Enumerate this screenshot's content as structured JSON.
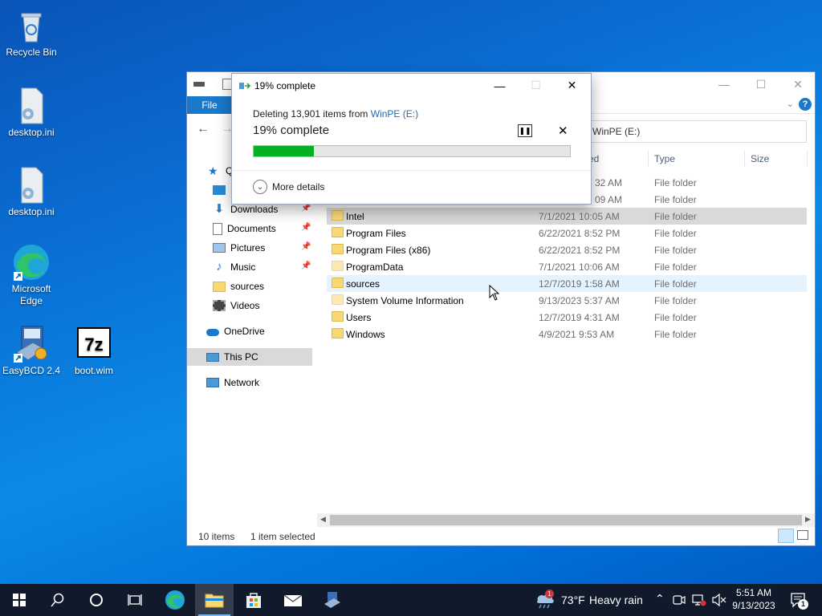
{
  "desktop": {
    "icons": [
      {
        "label": "Recycle Bin"
      },
      {
        "label": "desktop.ini"
      },
      {
        "label": "desktop.ini"
      },
      {
        "label": "Microsoft Edge"
      },
      {
        "label": "EasyBCD 2.4"
      },
      {
        "label": "boot.wim"
      }
    ]
  },
  "explorer": {
    "ribbon": {
      "file_tab": "File"
    },
    "address": "WinPE (E:)",
    "nav": {
      "quick_access": "Qu",
      "desktop": "D",
      "downloads": "Downloads",
      "documents": "Documents",
      "pictures": "Pictures",
      "music": "Music",
      "sources": "sources",
      "videos": "Videos",
      "onedrive": "OneDrive",
      "this_pc": "This PC",
      "network": "Network"
    },
    "columns": {
      "date": "ed",
      "type": "Type",
      "size": "Size"
    },
    "rows": [
      {
        "name": "",
        "date": "32 AM",
        "type": "File folder"
      },
      {
        "name": "",
        "date": "09 AM",
        "type": "File folder"
      },
      {
        "name": "Intel",
        "date": "7/1/2021 10:05 AM",
        "type": "File folder"
      },
      {
        "name": "Program Files",
        "date": "6/22/2021 8:52 PM",
        "type": "File folder"
      },
      {
        "name": "Program Files (x86)",
        "date": "6/22/2021 8:52 PM",
        "type": "File folder"
      },
      {
        "name": "ProgramData",
        "date": "7/1/2021 10:06 AM",
        "type": "File folder"
      },
      {
        "name": "sources",
        "date": "12/7/2019 1:58 AM",
        "type": "File folder"
      },
      {
        "name": "System Volume Information",
        "date": "9/13/2023 5:37 AM",
        "type": "File folder"
      },
      {
        "name": "Users",
        "date": "12/7/2019 4:31 AM",
        "type": "File folder"
      },
      {
        "name": "Windows",
        "date": "4/9/2021 9:53 AM",
        "type": "File folder"
      }
    ],
    "status": {
      "items": "10 items",
      "selected": "1 item selected"
    }
  },
  "dialog": {
    "title": "19% complete",
    "subtitle_prefix": "Deleting 13,901 items from ",
    "subtitle_link": "WinPE (E:)",
    "percent_text": "19% complete",
    "progress": 0.19,
    "more_details": "More details",
    "accent_color": "#06b025"
  },
  "taskbar": {
    "weather_temp": "73°F",
    "weather_desc": "Heavy rain",
    "weather_badge": "1",
    "time": "5:51 AM",
    "date": "9/13/2023",
    "notification_count": "1"
  }
}
